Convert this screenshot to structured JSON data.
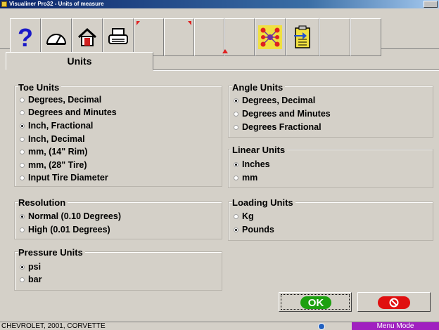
{
  "window": {
    "title": "Visualiner Pro32 - Units of measure"
  },
  "tabs": [
    {
      "label": "Units"
    }
  ],
  "groups": {
    "toe": {
      "title": "Toe Units",
      "options": [
        {
          "label": "Degrees, Decimal",
          "selected": false
        },
        {
          "label": "Degrees and Minutes",
          "selected": false
        },
        {
          "label": "Inch, Fractional",
          "selected": true
        },
        {
          "label": "Inch, Decimal",
          "selected": false
        },
        {
          "label": "mm, (14\" Rim)",
          "selected": false
        },
        {
          "label": "mm, (28\" Tire)",
          "selected": false
        },
        {
          "label": "Input Tire Diameter",
          "selected": false
        }
      ]
    },
    "resolution": {
      "title": "Resolution",
      "options": [
        {
          "label": "Normal (0.10 Degrees)",
          "selected": true
        },
        {
          "label": "High (0.01 Degrees)",
          "selected": false
        }
      ]
    },
    "pressure": {
      "title": "Pressure Units",
      "options": [
        {
          "label": "psi",
          "selected": true
        },
        {
          "label": "bar",
          "selected": false
        }
      ]
    },
    "angle": {
      "title": "Angle Units",
      "options": [
        {
          "label": "Degrees, Decimal",
          "selected": true
        },
        {
          "label": "Degrees and Minutes",
          "selected": false
        },
        {
          "label": "Degrees Fractional",
          "selected": false
        }
      ]
    },
    "linear": {
      "title": "Linear Units",
      "options": [
        {
          "label": "Inches",
          "selected": true
        },
        {
          "label": "mm",
          "selected": false
        }
      ]
    },
    "loading": {
      "title": "Loading Units",
      "options": [
        {
          "label": "Kg",
          "selected": false
        },
        {
          "label": "Pounds",
          "selected": true
        }
      ]
    }
  },
  "buttons": {
    "ok_label": "OK"
  },
  "toolbar": {
    "icons": [
      "help-icon",
      "gauge-icon",
      "home-icon",
      "printer-icon",
      "network-icon",
      "clipboard-import-icon"
    ]
  },
  "status": {
    "vehicle": "CHEVROLET, 2001, CORVETTE",
    "mode": "Menu Mode"
  },
  "colors": {
    "ok": "#1da010",
    "cancel": "#e01010",
    "mode_badge": "#a020c0",
    "help_icon": "#1a1ac8"
  }
}
